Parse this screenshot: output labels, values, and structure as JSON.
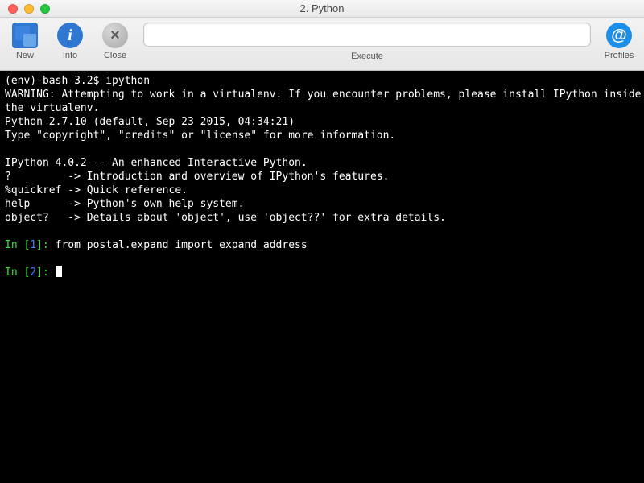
{
  "window": {
    "title": "2. Python"
  },
  "toolbar": {
    "new_label": "New",
    "info_label": "Info",
    "close_label": "Close",
    "execute_label": "Execute",
    "execute_value": "",
    "profiles_label": "Profiles"
  },
  "terminal": {
    "prompt_prefix": "(env)-bash-3.2$ ",
    "prompt_cmd": "ipython",
    "lines": [
      "WARNING: Attempting to work in a virtualenv. If you encounter problems, please install IPython inside",
      "the virtualenv.",
      "Python 2.7.10 (default, Sep 23 2015, 04:34:21)",
      "Type \"copyright\", \"credits\" or \"license\" for more information.",
      "",
      "IPython 4.0.2 -- An enhanced Interactive Python.",
      "?         -> Introduction and overview of IPython's features.",
      "%quickref -> Quick reference.",
      "help      -> Python's own help system.",
      "object?   -> Details about 'object', use 'object??' for extra details."
    ],
    "in1_label": "In [",
    "in1_num": "1",
    "in1_close": "]: ",
    "in1_code": "from postal.expand import expand_address",
    "in2_label": "In [",
    "in2_num": "2",
    "in2_close": "]: "
  }
}
